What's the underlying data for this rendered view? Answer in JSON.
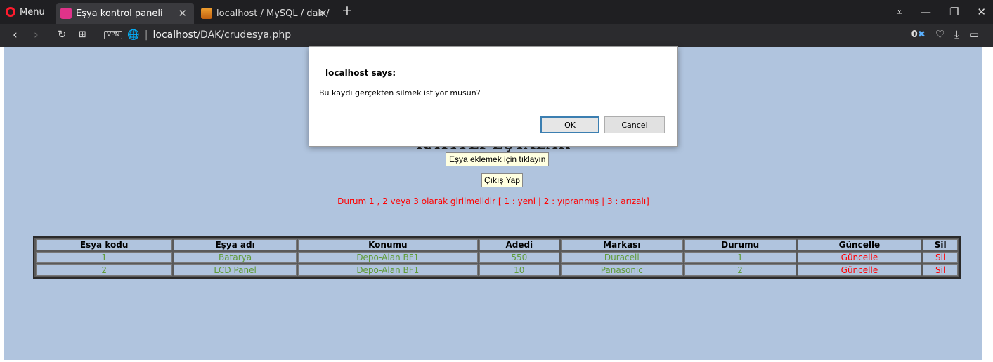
{
  "browser": {
    "menu_label": "Menu",
    "tabs": [
      {
        "title": "Eşya kontrol paneli",
        "active": true
      },
      {
        "title": "localhost / MySQL / dak / ",
        "active": false
      }
    ],
    "new_tab": "+",
    "url_host": "localhost",
    "url_path": "/DAK/crudesya.php",
    "vpn_label": "VPN",
    "adblock_count": "0"
  },
  "page": {
    "title": "KAYITLI EŞYALAR",
    "add_button": "Eşya eklemek için tıklayın",
    "logout_button": "Çıkış Yap",
    "info_text": "Durum 1 , 2 veya 3 olarak girilmelidir [ 1 : yeni | 2 : yıpranmış | 3 : arızalı]"
  },
  "table": {
    "headers": [
      "Esya kodu",
      "Eşya adı",
      "Konumu",
      "Adedi",
      "Markası",
      "Durumu",
      "Güncelle",
      "Sil"
    ],
    "rows": [
      [
        "1",
        "Batarya",
        "Depo-Alan BF1",
        "550",
        "Duracell",
        "1",
        "Güncelle",
        "Sil"
      ],
      [
        "2",
        "LCD Panel",
        "Depo-Alan BF1",
        "10",
        "Panasonic",
        "2",
        "Güncelle",
        "Sil"
      ]
    ]
  },
  "dialog": {
    "title": "localhost says:",
    "message": "Bu kaydı gerçekten silmek istiyor musun?",
    "ok_label": "OK",
    "cancel_label": "Cancel"
  },
  "colors": {
    "page_bg": "#b0c4de",
    "cell_text": "#5f9a37",
    "link_red": "#ff0000",
    "button_bg": "#ffffe0"
  }
}
